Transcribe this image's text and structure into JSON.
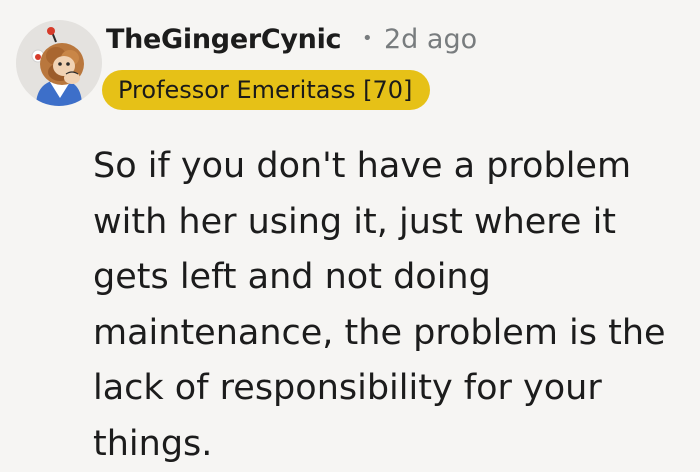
{
  "comment": {
    "avatar_icon": "snoo-avatar-icon",
    "username": "TheGingerCynic",
    "separator": "•",
    "timestamp": "2d ago",
    "flair": "Professor Emeritass [70]",
    "flair_color": "#e6c117",
    "body": "So if you don't have a problem with her using it, just where it gets left and not doing maintenance, the problem is the lack of responsibility for your things."
  }
}
